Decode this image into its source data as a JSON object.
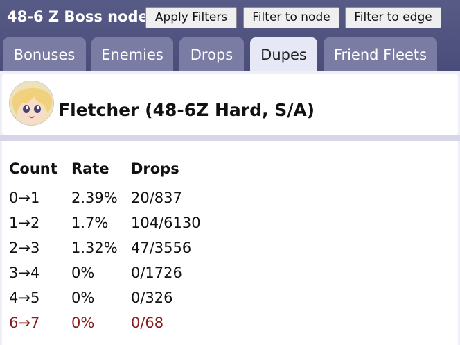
{
  "header": {
    "title": "48-6 Z Boss node",
    "buttons": {
      "apply_filters": "Apply Filters",
      "filter_to_node": "Filter to node",
      "filter_to_edge": "Filter to edge"
    }
  },
  "tabs": [
    {
      "label": "Bonuses",
      "active": false
    },
    {
      "label": "Enemies",
      "active": false
    },
    {
      "label": "Drops",
      "active": false
    },
    {
      "label": "Dupes",
      "active": true
    },
    {
      "label": "Friend Fleets",
      "active": false
    }
  ],
  "ship": {
    "title": "Fletcher (48-6Z Hard, S/A)"
  },
  "table": {
    "headers": [
      "Count",
      "Rate",
      "Drops"
    ],
    "rows": [
      {
        "count": "0→1",
        "rate": "2.39%",
        "drops": "20/837",
        "highlight": false
      },
      {
        "count": "1→2",
        "rate": "1.7%",
        "drops": "104/6130",
        "highlight": false
      },
      {
        "count": "2→3",
        "rate": "1.32%",
        "drops": "47/3556",
        "highlight": false
      },
      {
        "count": "3→4",
        "rate": "0%",
        "drops": "0/1726",
        "highlight": false
      },
      {
        "count": "4→5",
        "rate": "0%",
        "drops": "0/326",
        "highlight": false
      },
      {
        "count": "6→7",
        "rate": "0%",
        "drops": "0/68",
        "highlight": true
      }
    ]
  },
  "colors": {
    "header_bg": "#4f527f",
    "tab_bg": "#7a7ca4",
    "active_tab_bg": "#e7e8f5",
    "highlight_text": "#8a1b1b"
  }
}
